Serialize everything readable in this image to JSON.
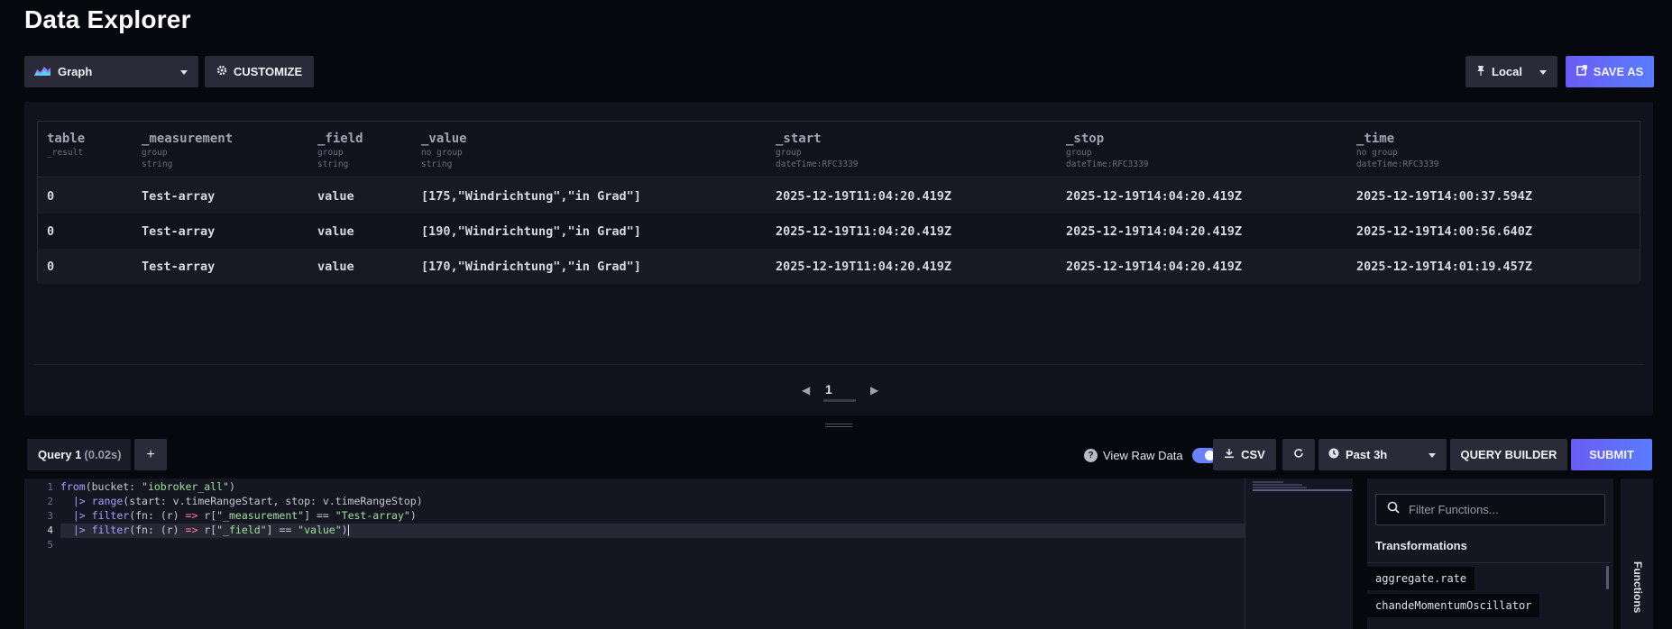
{
  "page": {
    "title": "Data Explorer"
  },
  "toolbar": {
    "view_type": "Graph",
    "customize_label": "CUSTOMIZE",
    "timezone": "Local",
    "save_as_label": "SAVE AS"
  },
  "table": {
    "columns": [
      {
        "name": "table",
        "group": "_result",
        "type": ""
      },
      {
        "name": "_measurement",
        "group": "group",
        "type": "string"
      },
      {
        "name": "_field",
        "group": "group",
        "type": "string"
      },
      {
        "name": "_value",
        "group": "no group",
        "type": "string"
      },
      {
        "name": "_start",
        "group": "group",
        "type": "dateTime:RFC3339"
      },
      {
        "name": "_stop",
        "group": "group",
        "type": "dateTime:RFC3339"
      },
      {
        "name": "_time",
        "group": "no group",
        "type": "dateTime:RFC3339"
      }
    ],
    "rows": [
      [
        "0",
        "Test-array",
        "value",
        "[175,\"Windrichtung\",\"in Grad\"]",
        "2025-12-19T11:04:20.419Z",
        "2025-12-19T14:04:20.419Z",
        "2025-12-19T14:00:37.594Z"
      ],
      [
        "0",
        "Test-array",
        "value",
        "[190,\"Windrichtung\",\"in Grad\"]",
        "2025-12-19T11:04:20.419Z",
        "2025-12-19T14:04:20.419Z",
        "2025-12-19T14:00:56.640Z"
      ],
      [
        "0",
        "Test-array",
        "value",
        "[170,\"Windrichtung\",\"in Grad\"]",
        "2025-12-19T11:04:20.419Z",
        "2025-12-19T14:04:20.419Z",
        "2025-12-19T14:01:19.457Z"
      ]
    ]
  },
  "pagination": {
    "current_page": "1"
  },
  "query": {
    "tab_label": "Query 1",
    "duration": "(0.02s)",
    "add_label": "+",
    "view_raw_label": "View Raw Data",
    "raw_toggle_on": true,
    "csv_label": "CSV",
    "time_range": "Past 3h",
    "query_builder_label": "QUERY BUILDER",
    "submit_label": "SUBMIT",
    "line_numbers": [
      "1",
      "2",
      "3",
      "4",
      "5"
    ]
  },
  "editor": {
    "line1": {
      "fn": "from",
      "pre": "(bucket: ",
      "str": "\"iobroker_all\"",
      "post": ")"
    },
    "line2": {
      "pipe": "|>",
      "fn": "range",
      "rest": "(start: v.timeRangeStart, stop: v.timeRangeStop)"
    },
    "line3": {
      "pipe": "|>",
      "fn": "filter",
      "pre": "(fn: (r) ",
      "arrow": "=>",
      "mid": " r[",
      "key": "\"_measurement\"",
      "eq": "] == ",
      "val": "\"Test-array\"",
      "post": ")"
    },
    "line4": {
      "pipe": "|>",
      "fn": "filter",
      "pre": "(fn: (r) ",
      "arrow": "=>",
      "mid": " r[",
      "key": "\"_field\"",
      "eq": "] == ",
      "val": "\"value\"",
      "post": ")"
    }
  },
  "functions": {
    "search_placeholder": "Filter Functions...",
    "category": "Transformations",
    "items": [
      "aggregate.rate",
      "chandeMomentumOscillator"
    ],
    "tab_label": "Functions"
  },
  "colors": {
    "accent": "#6a82ff",
    "background": "#07070e",
    "panel": "#12121c"
  }
}
